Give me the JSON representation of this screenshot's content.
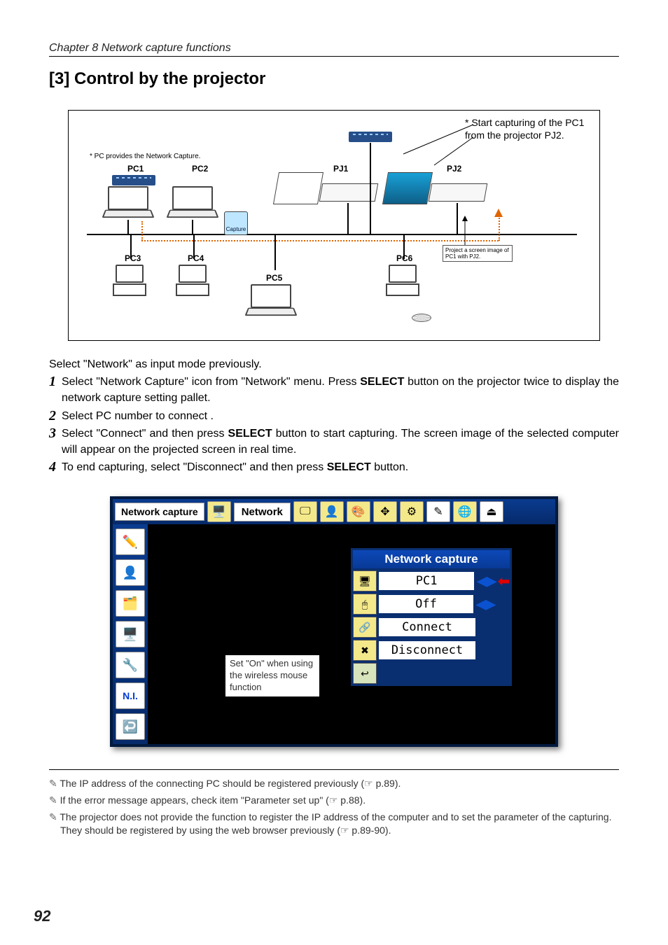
{
  "chapter_header": "Chapter 8 Network capture functions",
  "section_heading": "[3] Control by the projector",
  "diagram": {
    "callout_right": "* Start capturing of the PC1 from the projector PJ2.",
    "note_pc_provides": "* PC provides the Network Capture.",
    "labels": {
      "pc1": "PC1",
      "pc2": "PC2",
      "pc3": "PC3",
      "pc4": "PC4",
      "pc5": "PC5",
      "pc6": "PC6",
      "pj1": "PJ1",
      "pj2": "PJ2"
    },
    "capture_chip": "Capture",
    "project_box": "Project a screen image of PC1 with PJ2."
  },
  "intro_text": "Select \"Network\" as input mode previously.",
  "steps": [
    {
      "pre": "Select \"Network Capture\" icon from \"Network\" menu. Press ",
      "bold": "SELECT",
      "post": " button on the projector twice to display the network capture setting pallet."
    },
    {
      "pre": "Select PC number to connect .",
      "bold": "",
      "post": ""
    },
    {
      "pre": "Select \"Connect\" and then press ",
      "bold": "SELECT",
      "post": " button to start capturing. The screen image of the selected computer will appear on the projected screen in real time."
    },
    {
      "pre": "To end capturing, select \"Disconnect\" and then press ",
      "bold": "SELECT",
      "post": " button."
    }
  ],
  "menu": {
    "title_box": "Network capture",
    "group_label": "Network",
    "side_ni": "N.I.",
    "callout": "Set \"On\" when using the wireless mouse function",
    "panel": {
      "title": "Network capture",
      "rows": {
        "pc": "PC1",
        "off": "Off",
        "connect": "Connect",
        "disconnect": "Disconnect"
      }
    }
  },
  "footnotes": {
    "f1": "The IP address of the connecting PC should be registered previously (☞ p.89).",
    "f2": "If the error message appears, check item \"Parameter set up\"  (☞ p.88).",
    "f3": "The projector does not provide the function to register the IP address of the computer and to set the parameter of the capturing. They should be registered by using the web browser previously (☞ p.89-90)."
  },
  "page_number": "92"
}
